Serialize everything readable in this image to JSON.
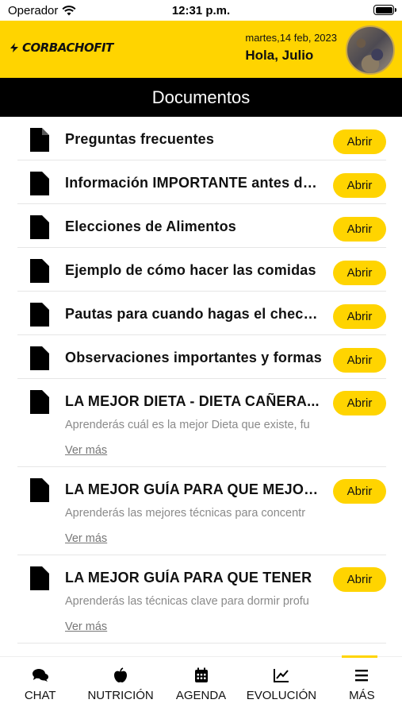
{
  "status_bar": {
    "carrier": "Operador",
    "time": "12:31 p.m."
  },
  "header": {
    "brand": "CORBACHOFIT",
    "date": "martes,14 feb, 2023",
    "greeting": "Hola, Julio"
  },
  "title": "Documentos",
  "documents": [
    {
      "title": "Preguntas frecuentes",
      "button": "Abrir"
    },
    {
      "title": "Información IMPORTANTE antes de empezar",
      "button": "Abrir"
    },
    {
      "title": "Elecciones de Alimentos",
      "button": "Abrir"
    },
    {
      "title": "Ejemplo de cómo hacer las comidas",
      "button": "Abrir"
    },
    {
      "title": "Pautas para cuando hagas el check-in",
      "button": "Abrir"
    },
    {
      "title": "Observaciones importantes y formas",
      "button": "Abrir"
    },
    {
      "title": "LA MEJOR DIETA - DIETA CAÑERA...",
      "description": "Aprenderás cuál es la mejor Dieta que existe, fu",
      "more": "Ver más",
      "button": "Abrir"
    },
    {
      "title": "LA MEJOR GUÍA PARA QUE MEJORES",
      "description": "Aprenderás las mejores técnicas para concentr",
      "more": "Ver más",
      "button": "Abrir"
    },
    {
      "title": "LA MEJOR GUÍA PARA QUE TENER",
      "description": "Aprenderás las técnicas clave para dormir profu",
      "more": "Ver más",
      "button": "Abrir"
    }
  ],
  "tabs": [
    {
      "label": "CHAT",
      "icon": "chat-icon"
    },
    {
      "label": "NUTRICIÓN",
      "icon": "apple-icon"
    },
    {
      "label": "AGENDA",
      "icon": "calendar-icon"
    },
    {
      "label": "EVOLUCIÓN",
      "icon": "chart-line-icon"
    },
    {
      "label": "MÁS",
      "icon": "menu-icon",
      "active": true
    }
  ],
  "colors": {
    "accent": "#ffd400",
    "title_bar": "#000000"
  }
}
